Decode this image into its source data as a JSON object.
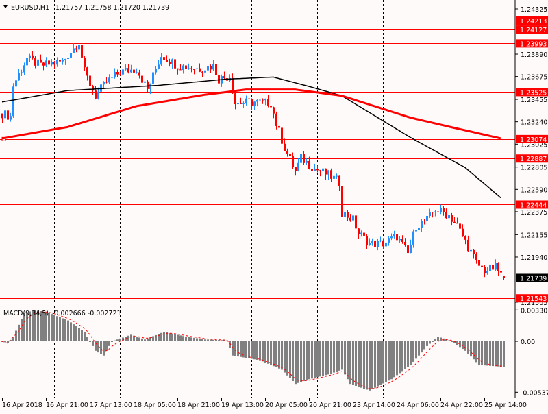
{
  "header": {
    "symbol": "EURUSD,H1",
    "ohlc": "1.21757 1.21758 1.21720 1.21739"
  },
  "macd_header": {
    "label": "MACD(9,34,5)",
    "values": "-0.002666 -0.002721"
  },
  "colors": {
    "background": "#fffafa",
    "bull": "#1e90ff",
    "bear": "#ff0000",
    "level_line": "#ff0000",
    "ma_fast": "#000000",
    "ma_slow": "#ff0000",
    "macd_hist": "#808080",
    "macd_signal": "#ff0000",
    "current_price_line": "#c0c0c0"
  },
  "chart_data": [
    {
      "type": "candlestick",
      "title": "EURUSD,H1",
      "ylim": [
        1.21505,
        1.24325
      ],
      "price_axis_ticks": [
        "1.24325",
        "1.23890",
        "1.23675",
        "1.23455",
        "1.23240",
        "1.23025",
        "1.22805",
        "1.22590",
        "1.22375",
        "1.22155",
        "1.21940",
        "1.21505"
      ],
      "time_axis_labels": [
        "16 Apr 2018",
        "16 Apr 21:00",
        "17 Apr 13:00",
        "18 Apr 05:00",
        "18 Apr 21:00",
        "19 Apr 13:00",
        "20 Apr 05:00",
        "20 Apr 21:00",
        "23 Apr 14:00",
        "24 Apr 06:00",
        "24 Apr 22:00",
        "25 Apr 14:00"
      ],
      "bars_per_label": 16,
      "bar_count": 184,
      "close_path_keypoints": [
        [
          0,
          1.2332
        ],
        [
          3,
          1.2329
        ],
        [
          4,
          1.2359
        ],
        [
          9,
          1.2385
        ],
        [
          14,
          1.2378
        ],
        [
          22,
          1.2382
        ],
        [
          28,
          1.2401
        ],
        [
          30,
          1.2372
        ],
        [
          34,
          1.2349
        ],
        [
          38,
          1.2362
        ],
        [
          43,
          1.2372
        ],
        [
          49,
          1.2375
        ],
        [
          53,
          1.2355
        ],
        [
          58,
          1.2388
        ],
        [
          64,
          1.2378
        ],
        [
          72,
          1.2375
        ],
        [
          77,
          1.2378
        ],
        [
          79,
          1.2365
        ],
        [
          83,
          1.2368
        ],
        [
          85,
          1.2342
        ],
        [
          92,
          1.2343
        ],
        [
          98,
          1.2342
        ],
        [
          100,
          1.2322
        ],
        [
          103,
          1.2299
        ],
        [
          107,
          1.2276
        ],
        [
          109,
          1.2289
        ],
        [
          114,
          1.2279
        ],
        [
          119,
          1.2273
        ],
        [
          123,
          1.2266
        ],
        [
          124,
          1.2237
        ],
        [
          128,
          1.223
        ],
        [
          130,
          1.2217
        ],
        [
          134,
          1.2207
        ],
        [
          139,
          1.2207
        ],
        [
          144,
          1.2214
        ],
        [
          148,
          1.2197
        ],
        [
          151,
          1.2224
        ],
        [
          155,
          1.223
        ],
        [
          158,
          1.224
        ],
        [
          163,
          1.2234
        ],
        [
          166,
          1.2224
        ],
        [
          170,
          1.2204
        ],
        [
          173,
          1.2188
        ],
        [
          176,
          1.2181
        ],
        [
          180,
          1.2184
        ],
        [
          183,
          1.21739
        ]
      ],
      "last_bar": {
        "open": 1.21757,
        "high": 1.21758,
        "low": 1.2172,
        "close": 1.21739
      },
      "horizontal_levels": [
        "1.24213",
        "1.24127",
        "1.23993",
        "1.23525",
        "1.23074",
        "1.22887",
        "1.22444",
        "1.21543"
      ],
      "current_price": "1.21739",
      "moving_averages": [
        {
          "name": "MA fast",
          "color": "#000000",
          "keypoints": [
            [
              0,
              1.2343
            ],
            [
              24,
              1.2354
            ],
            [
              57,
              1.2359
            ],
            [
              82,
              1.2365
            ],
            [
              99,
              1.2367
            ],
            [
              112,
              1.2358
            ],
            [
              124,
              1.2349
            ],
            [
              149,
              1.2309
            ],
            [
              169,
              1.228
            ],
            [
              182,
              1.2251
            ]
          ]
        },
        {
          "name": "MA slow",
          "color": "#ff0000",
          "keypoints": [
            [
              0,
              1.2308
            ],
            [
              24,
              1.2319
            ],
            [
              49,
              1.2339
            ],
            [
              74,
              1.235
            ],
            [
              89,
              1.2355
            ],
            [
              107,
              1.2355
            ],
            [
              124,
              1.2349
            ],
            [
              149,
              1.2328
            ],
            [
              162,
              1.232
            ],
            [
              182,
              1.2308
            ]
          ]
        }
      ]
    },
    {
      "type": "bar",
      "title": "MACD(9,34,5)",
      "ylim": [
        -0.005378,
        0.003306
      ],
      "axis_ticks": [
        "0.003306",
        "0.00",
        "-0.005378"
      ],
      "histogram_keypoints": [
        [
          0,
          0.0
        ],
        [
          2,
          -0.0002
        ],
        [
          4,
          0.0005
        ],
        [
          8,
          0.003
        ],
        [
          12,
          0.0033
        ],
        [
          17,
          0.003
        ],
        [
          24,
          0.0022
        ],
        [
          30,
          0.001
        ],
        [
          34,
          -0.001
        ],
        [
          37,
          -0.0015
        ],
        [
          40,
          0.0
        ],
        [
          47,
          0.0007
        ],
        [
          52,
          0.0002
        ],
        [
          59,
          0.001
        ],
        [
          67,
          0.0005
        ],
        [
          74,
          0.0002
        ],
        [
          82,
          0.0001
        ],
        [
          84,
          -0.0015
        ],
        [
          94,
          -0.002
        ],
        [
          102,
          -0.003
        ],
        [
          107,
          -0.0045
        ],
        [
          112,
          -0.004
        ],
        [
          119,
          -0.0035
        ],
        [
          124,
          -0.003
        ],
        [
          127,
          -0.0045
        ],
        [
          134,
          -0.0052
        ],
        [
          142,
          -0.004
        ],
        [
          149,
          -0.0025
        ],
        [
          155,
          -0.0005
        ],
        [
          159,
          0.0005
        ],
        [
          164,
          0.0
        ],
        [
          169,
          -0.001
        ],
        [
          174,
          -0.0025
        ],
        [
          183,
          -0.0027
        ]
      ],
      "signal_last": -0.002721,
      "main_last": -0.002666
    }
  ]
}
